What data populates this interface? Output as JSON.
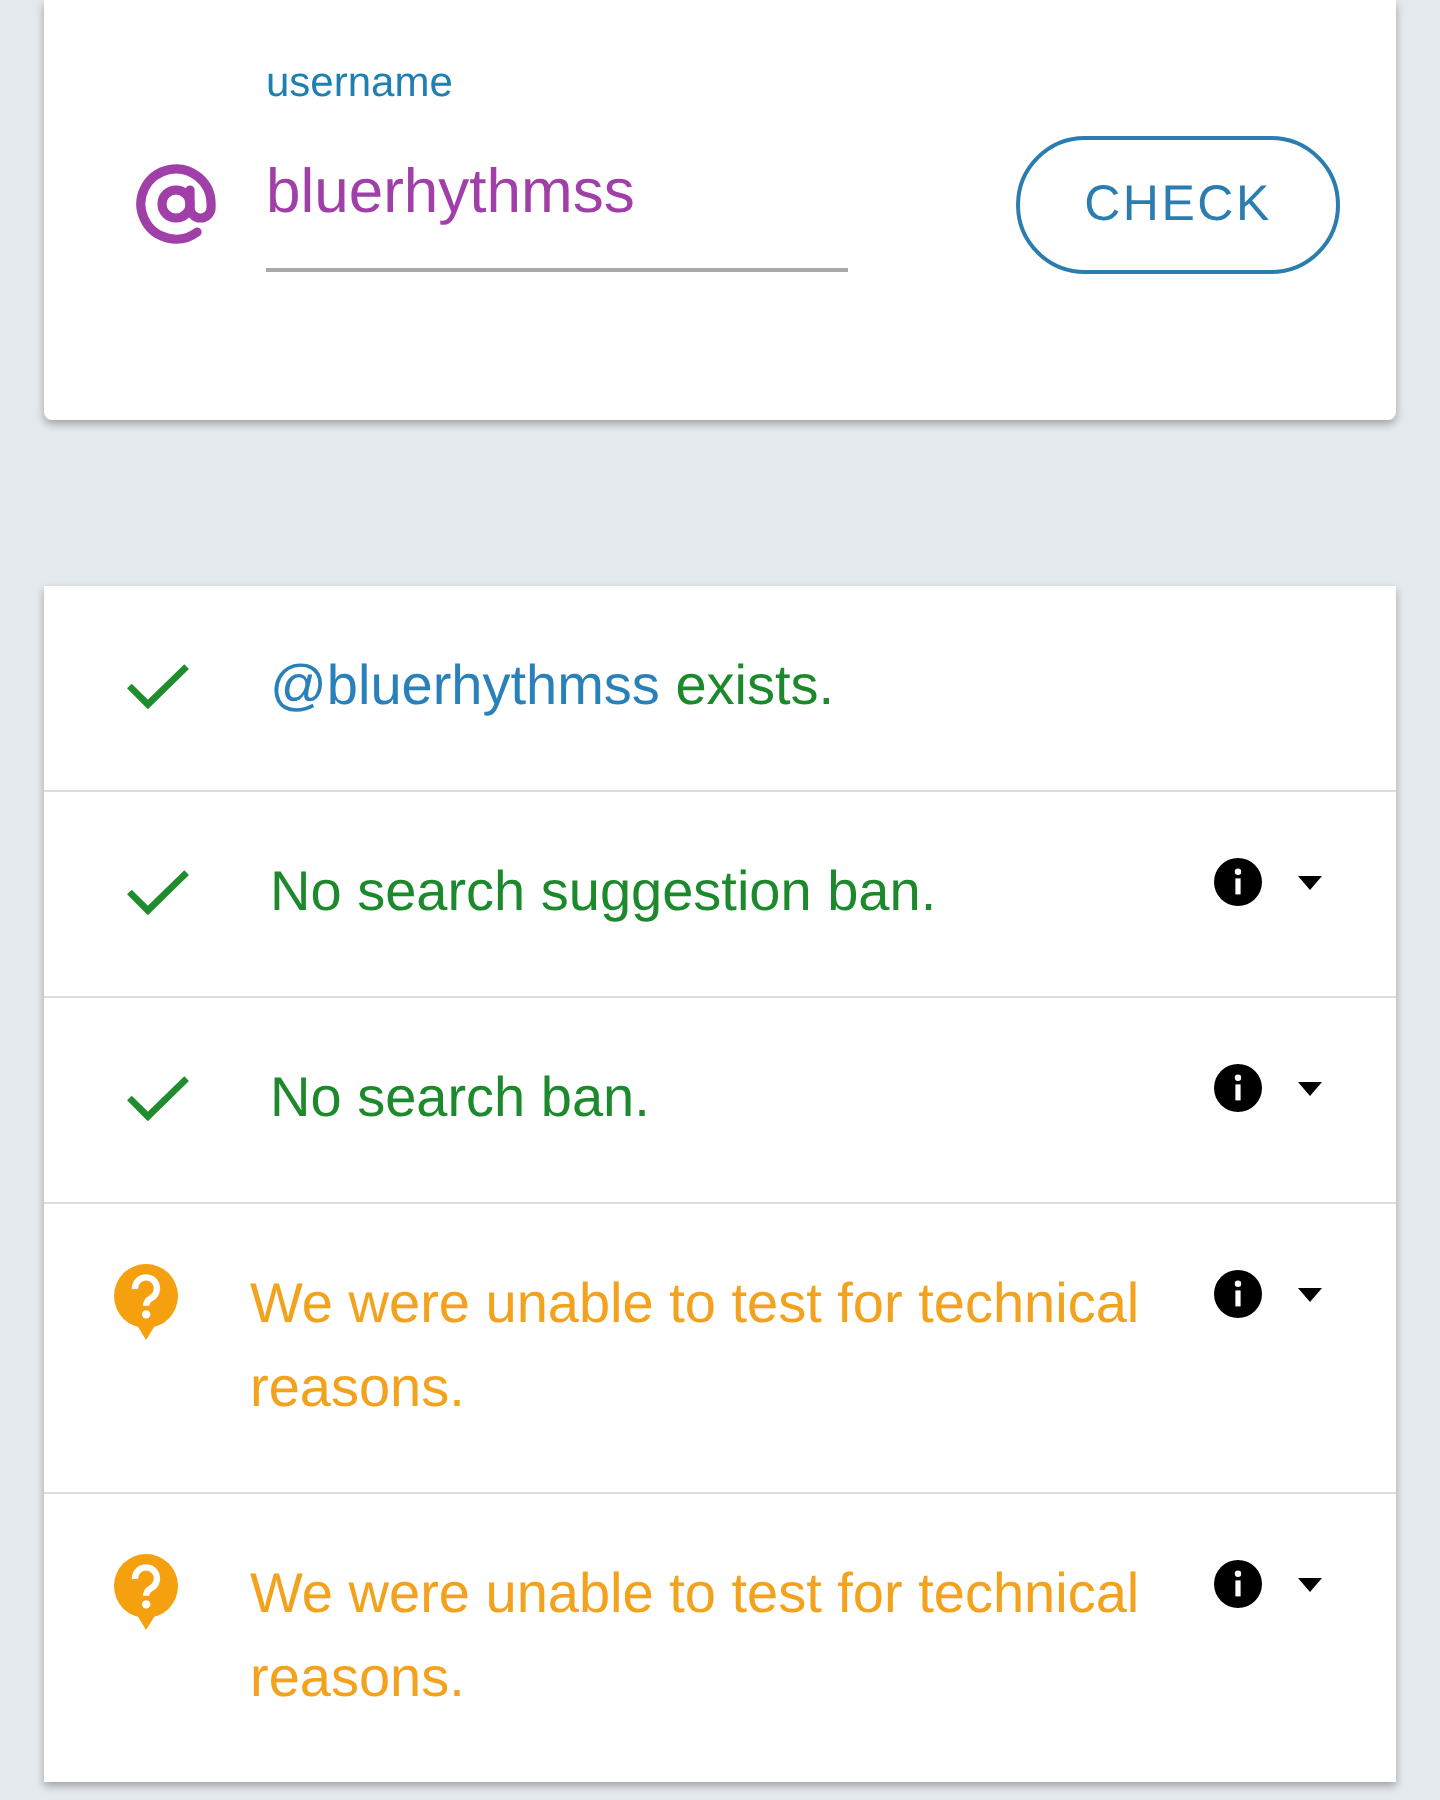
{
  "username_field": {
    "label": "username",
    "value": "bluerhythmss"
  },
  "check_button": {
    "label": "CHECK"
  },
  "results": [
    {
      "kind": "passed",
      "handle": "@bluerhythmss",
      "text": "exists.",
      "info": false
    },
    {
      "kind": "passed",
      "text": "No search suggestion ban.",
      "info": true
    },
    {
      "kind": "passed",
      "text": "No search ban.",
      "info": true
    },
    {
      "kind": "unknown",
      "text": "We were unable to test for technical reasons.",
      "info": true
    },
    {
      "kind": "unknown",
      "text": "We were unable to test for technical reasons.",
      "info": true
    }
  ]
}
